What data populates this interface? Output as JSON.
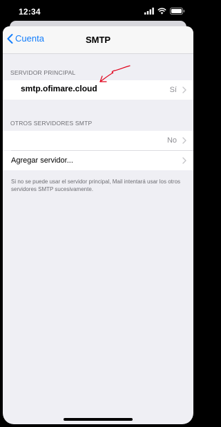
{
  "status_bar": {
    "time": "12:34"
  },
  "nav": {
    "back_label": "Cuenta",
    "title": "SMTP"
  },
  "primary_section": {
    "header": "SERVIDOR PRINCIPAL",
    "server_name": "smtp.ofimare.cloud",
    "value": "Sí"
  },
  "other_section": {
    "header": "OTROS SERVIDORES SMTP",
    "row_value": "No",
    "add_label": "Agregar servidor...",
    "footer": "Si no se puede usar el servidor principal, Mail intentará usar los otros servidores SMTP sucesivamente."
  },
  "colors": {
    "accent": "#147efb",
    "annotation": "#e0001a"
  }
}
